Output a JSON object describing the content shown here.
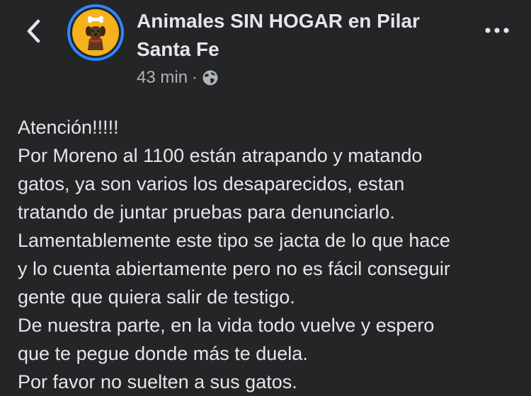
{
  "header": {
    "back_icon": "chevron-left-icon",
    "avatar_icon": "dog-with-bone-logo",
    "page_name": "Animales SIN HOGAR en Pilar Santa Fe",
    "time_ago": "43 min",
    "separator": "·",
    "privacy_icon": "globe-icon",
    "more_icon": "more-horizontal-icon"
  },
  "post": {
    "lines": [
      "Atención!!!!!",
      "Por Moreno al 1100 están atrapando y matando",
      "gatos, ya son varios los desaparecidos, estan",
      "tratando de juntar pruebas para denunciarlo.",
      "Lamentablemente este tipo se jacta de lo que hace",
      "y lo cuenta abiertamente pero no es fácil conseguir",
      "gente que quiera salir de testigo.",
      "De nuestra parte, en la vida todo vuelve y espero",
      "que te pegue donde más te duela.",
      "Por favor no suelten a sus gatos."
    ]
  },
  "colors": {
    "background": "#242526",
    "text_primary": "#e4e6eb",
    "text_secondary": "#b0b3b8",
    "avatar_ring": "#2d88ff",
    "avatar_fill": "#f5b21c"
  }
}
